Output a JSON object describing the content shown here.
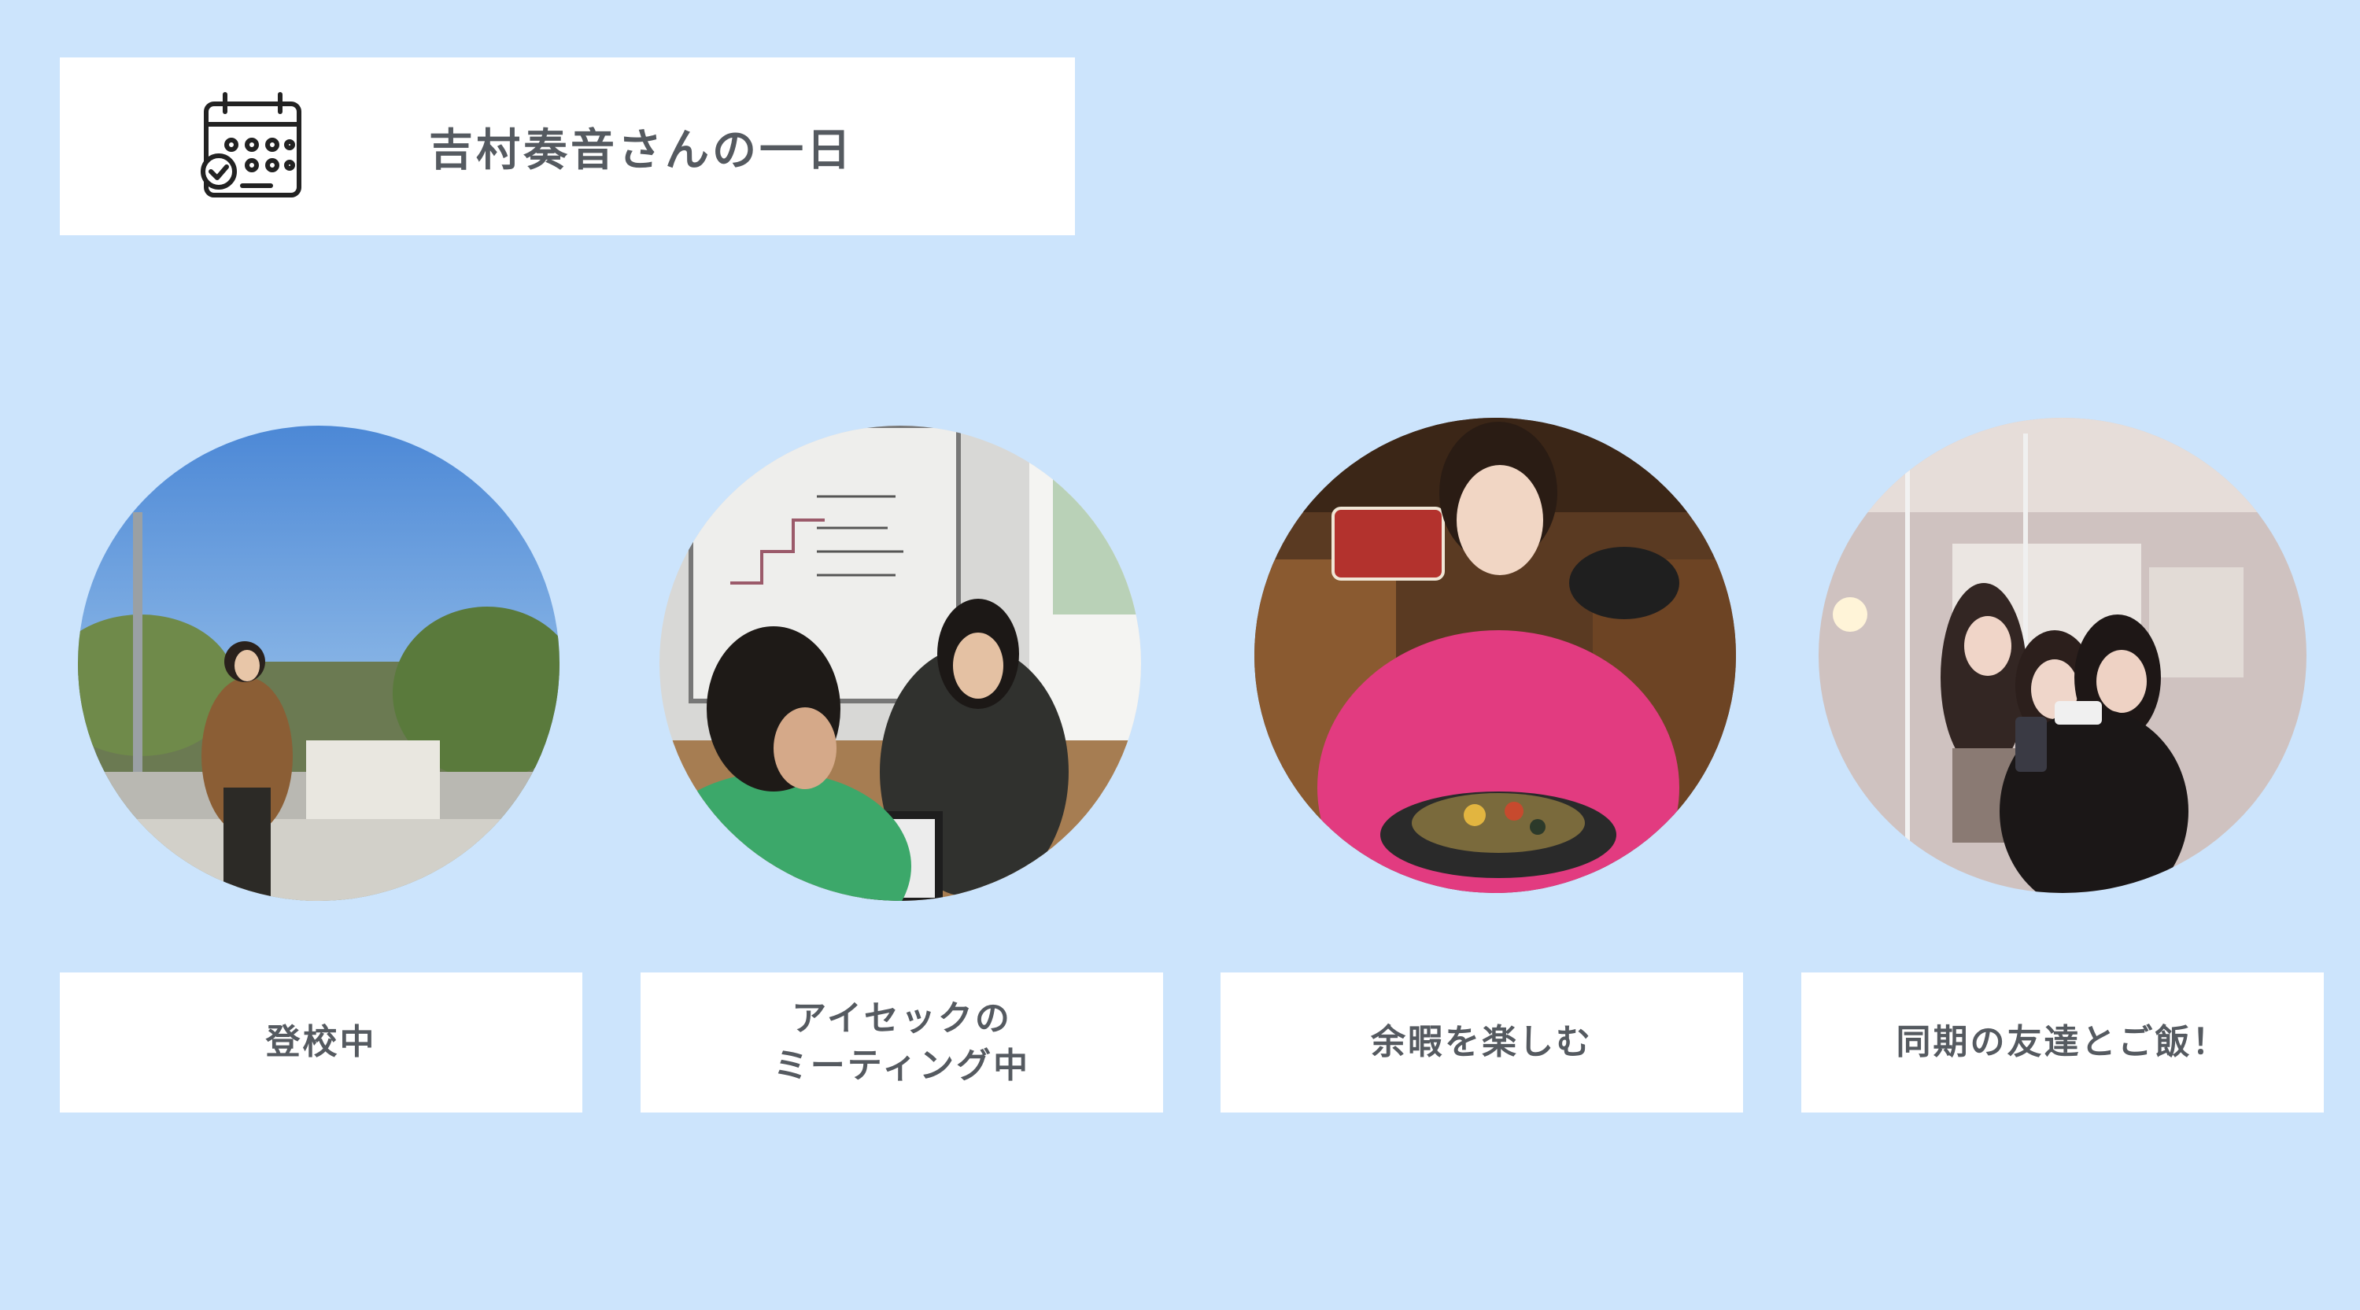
{
  "header": {
    "title": "吉村奏音さんの一日",
    "icon": "calendar-icon"
  },
  "activities": [
    {
      "label_lines": [
        "登校中"
      ],
      "photo": "student-walking-outdoors-photo"
    },
    {
      "label_lines": [
        "アイセックの",
        "ミーティング中"
      ],
      "photo": "meeting-photo"
    },
    {
      "label_lines": [
        "余暇を楽しむ"
      ],
      "photo": "restaurant-dish-photo"
    },
    {
      "label_lines": [
        "同期の友達とご飯！"
      ],
      "photo": "friends-selfie-photo"
    }
  ],
  "colors": {
    "background": "#cce4fc",
    "card": "#ffffff",
    "text": "#555a60"
  }
}
